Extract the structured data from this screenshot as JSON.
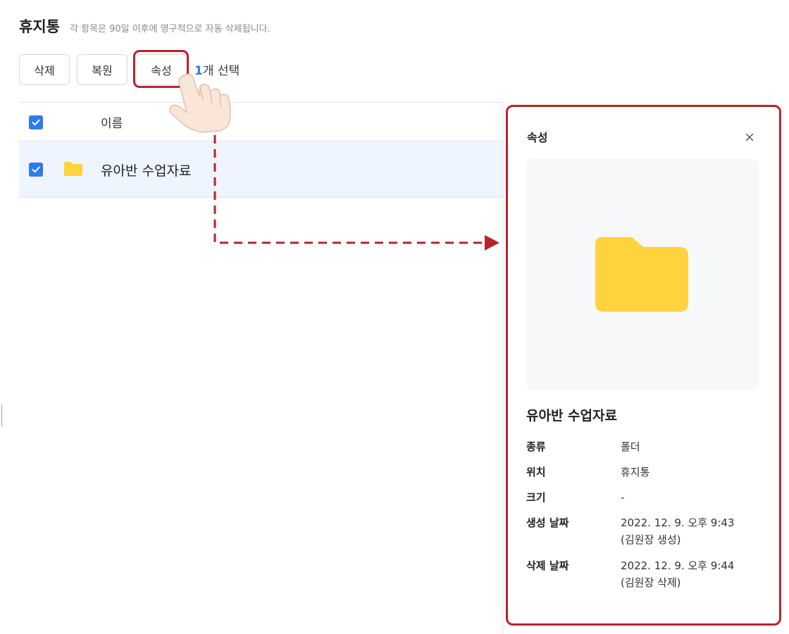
{
  "header": {
    "title": "휴지통",
    "subtitle": "각 항목은 90일 이후에 영구적으로 자동 삭제됩니다."
  },
  "toolbar": {
    "delete_label": "삭제",
    "restore_label": "복원",
    "properties_label": "속성",
    "selected_count": "1",
    "selected_suffix": "개 선택"
  },
  "table": {
    "column_name": "이름",
    "rows": [
      {
        "name": "유아반 수업자료",
        "type_icon": "folder-icon",
        "checked": true
      }
    ]
  },
  "panel": {
    "title": "속성",
    "close_icon": "close-icon",
    "file_name": "유아반 수업자료",
    "props": [
      {
        "label": "종류",
        "value": "폴더"
      },
      {
        "label": "위치",
        "value": "휴지통"
      },
      {
        "label": "크기",
        "value": "-"
      },
      {
        "label": "생성 날짜",
        "value": "2022. 12. 9. 오후 9:43",
        "value2": "(김원장 생성)"
      },
      {
        "label": "삭제 날짜",
        "value": "2022. 12. 9. 오후 9:44",
        "value2": "(김원장 삭제)"
      }
    ]
  },
  "colors": {
    "accent_blue": "#2f7bea",
    "folder_yellow": "#ffd33d",
    "highlight_red": "#b8222a",
    "selected_row_bg": "#eef5fe"
  }
}
